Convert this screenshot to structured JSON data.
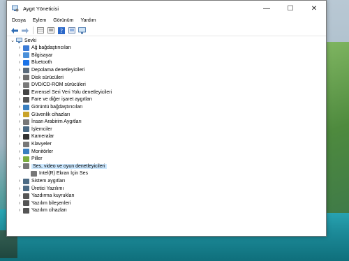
{
  "window": {
    "title": "Aygıt Yöneticisi",
    "controls": {
      "minimize": "—",
      "maximize": "☐",
      "close": "✕"
    }
  },
  "menu": [
    "Dosya",
    "Eylem",
    "Görünüm",
    "Yardım"
  ],
  "toolbar": [
    "back-icon",
    "forward-icon",
    "grid-icon",
    "properties-icon",
    "help-icon",
    "view-icon",
    "monitor-icon"
  ],
  "tree": {
    "root": "Sevki",
    "items": [
      {
        "label": "Ağ bağdaştırıcıları",
        "icon": "network-adapter-icon",
        "color": "#3b7bd6"
      },
      {
        "label": "Bilgisayar",
        "icon": "computer-icon",
        "color": "#4a90d9"
      },
      {
        "label": "Bluetooth",
        "icon": "bluetooth-icon",
        "color": "#1b73e8"
      },
      {
        "label": "Depolama denetleyicileri",
        "icon": "storage-controller-icon",
        "color": "#5b6b7b"
      },
      {
        "label": "Disk sürücüleri",
        "icon": "disk-drive-icon",
        "color": "#6d6d6d"
      },
      {
        "label": "DVD/CD-ROM sürücüleri",
        "icon": "dvd-drive-icon",
        "color": "#7a7a7a"
      },
      {
        "label": "Evrensel Seri Veri Yolu denetleyicileri",
        "icon": "usb-icon",
        "color": "#444444"
      },
      {
        "label": "Fare ve diğer işaret aygıtları",
        "icon": "mouse-icon",
        "color": "#555555"
      },
      {
        "label": "Görüntü bağdaştırıcıları",
        "icon": "display-adapter-icon",
        "color": "#3a7fbf"
      },
      {
        "label": "Güvenlik cihazları",
        "icon": "security-device-icon",
        "color": "#c9a227"
      },
      {
        "label": "İnsan Arabirim Aygıtları",
        "icon": "hid-icon",
        "color": "#777777"
      },
      {
        "label": "İşlemciler",
        "icon": "processor-icon",
        "color": "#4b6a84"
      },
      {
        "label": "Kameralar",
        "icon": "camera-icon",
        "color": "#333333"
      },
      {
        "label": "Klavyeler",
        "icon": "keyboard-icon",
        "color": "#777777"
      },
      {
        "label": "Monitörler",
        "icon": "monitor-icon",
        "color": "#3a7fbf"
      },
      {
        "label": "Piller",
        "icon": "battery-icon",
        "color": "#7cae3f"
      },
      {
        "label": "Ses, video ve oyun denetleyicileri",
        "icon": "audio-icon",
        "color": "#777777",
        "expanded": true,
        "children": [
          {
            "label": "Intel(R) Ekran İçin Ses",
            "icon": "speaker-icon",
            "color": "#777777"
          }
        ]
      },
      {
        "label": "Sistem aygıtları",
        "icon": "system-devices-icon",
        "color": "#4b6a84"
      },
      {
        "label": "Üretici Yazılımı",
        "icon": "firmware-icon",
        "color": "#4b6a84"
      },
      {
        "label": "Yazdırma kuyrukları",
        "icon": "printer-icon",
        "color": "#555555"
      },
      {
        "label": "Yazılım bileşenleri",
        "icon": "software-component-icon",
        "color": "#555555"
      },
      {
        "label": "Yazılım cihazları",
        "icon": "software-device-icon",
        "color": "#555555"
      }
    ]
  }
}
